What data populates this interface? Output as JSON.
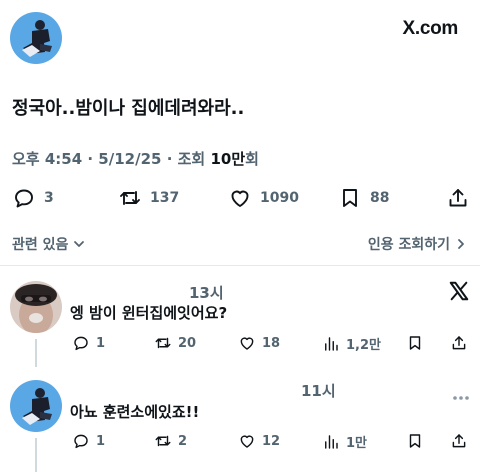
{
  "header": {
    "brand": "X.com"
  },
  "tweet": {
    "text": "정국아..밤이나 집에데려와라..",
    "time": "오후 4:54",
    "date": "5/12/25",
    "views_label": "조회",
    "views_count": "10만",
    "views_unit": "회",
    "stats": {
      "replies": "3",
      "reposts": "137",
      "likes": "1090",
      "bookmarks": "88"
    }
  },
  "links": {
    "related": "관련 있음",
    "quote_views": "인용 조회하기"
  },
  "replies": [
    {
      "time": "13시",
      "text": "엥 밤이 윈터집에잇어요?",
      "stats": {
        "replies": "1",
        "reposts": "20",
        "likes": "18",
        "views": "1,2만"
      }
    },
    {
      "time": "11시",
      "text": "아뇨 훈련소에있죠!!",
      "stats": {
        "replies": "1",
        "reposts": "2",
        "likes": "12",
        "views": "1만"
      }
    }
  ],
  "colors": {
    "text": "#0f1419",
    "muted": "#536471",
    "avatar_bg": "#5aa7e6"
  },
  "icons": [
    "reply-icon",
    "repost-icon",
    "like-icon",
    "bookmark-icon",
    "share-icon",
    "views-icon",
    "x-logo-icon",
    "more-icon",
    "chevron-down-icon",
    "chevron-right-icon"
  ]
}
